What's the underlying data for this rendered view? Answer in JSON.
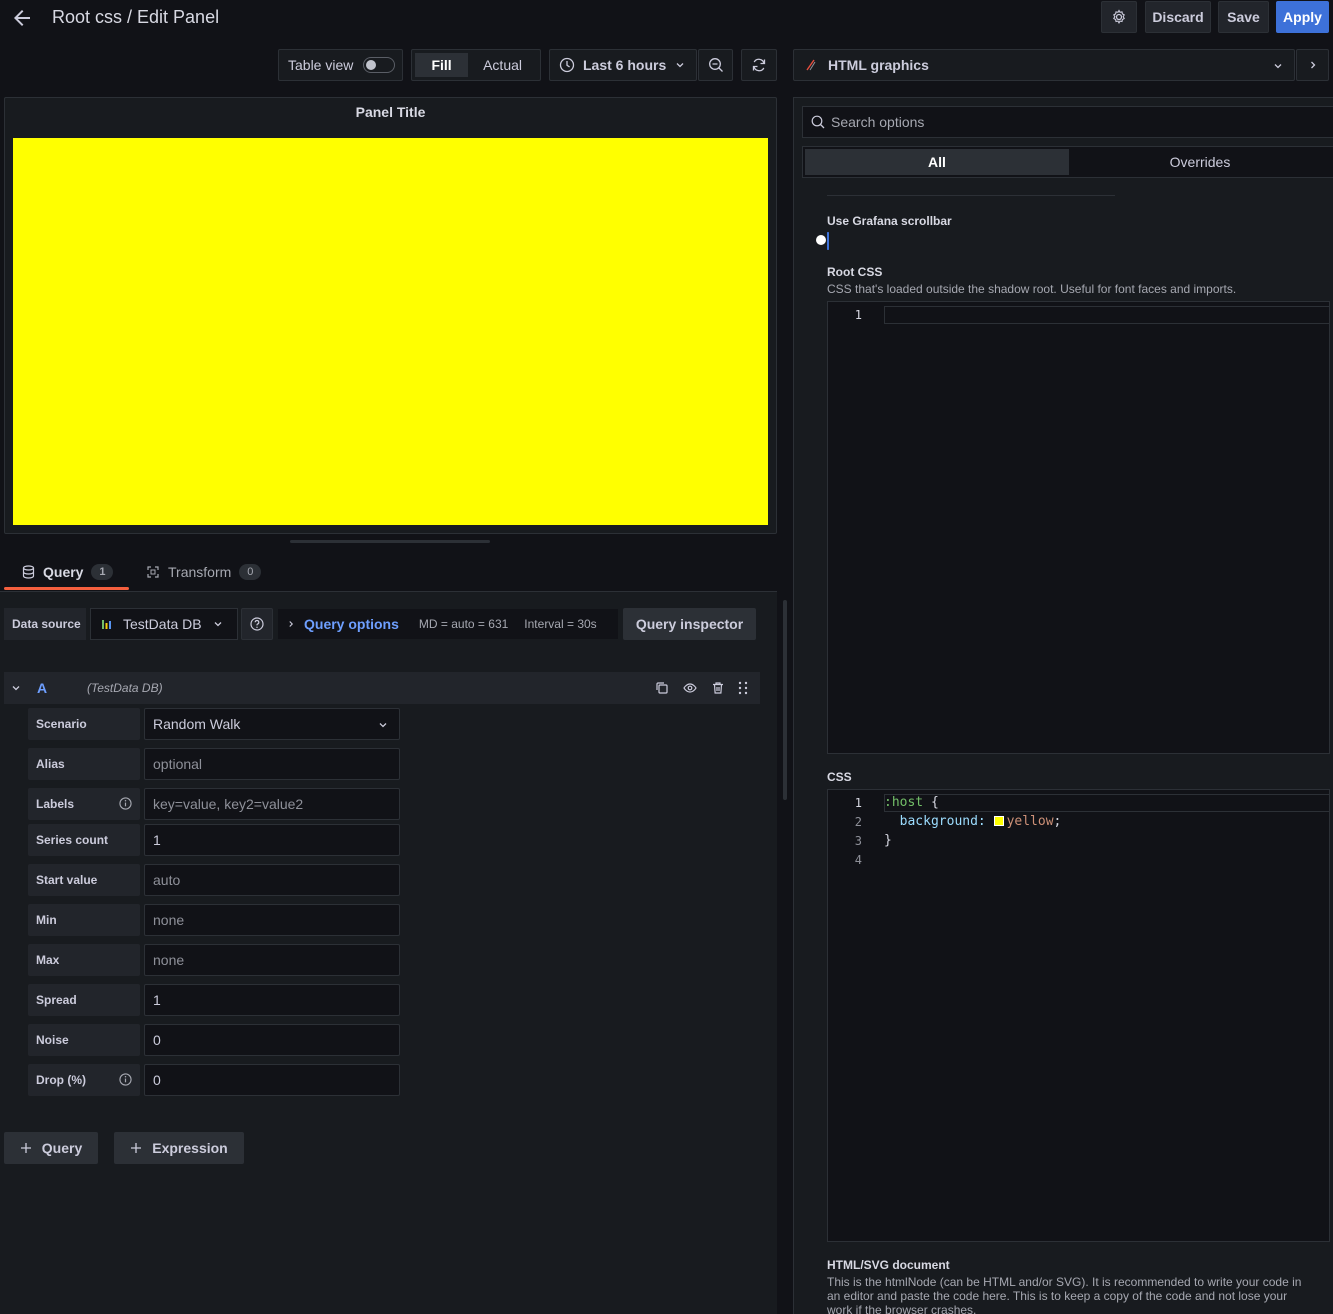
{
  "header": {
    "title": "Root css / Edit Panel",
    "discard_label": "Discard",
    "save_label": "Save",
    "apply_label": "Apply"
  },
  "toolbar": {
    "table_view_label": "Table view",
    "fill_label": "Fill",
    "actual_label": "Actual",
    "time_range": "Last 6 hours",
    "visualization": "HTML graphics"
  },
  "panel": {
    "title": "Panel Title",
    "background_color": "#ffff00"
  },
  "query_tabs": [
    {
      "label": "Query",
      "count": "1"
    },
    {
      "label": "Transform",
      "count": "0"
    }
  ],
  "datasource_row": {
    "data_source_label": "Data source",
    "data_source_value": "TestData DB",
    "query_options_label": "Query options",
    "md_label": "MD = auto = 631",
    "interval_label": "Interval = 30s",
    "inspector_label": "Query inspector"
  },
  "query_row": {
    "ref_id": "A",
    "datasource": "(TestData DB)"
  },
  "fields": [
    {
      "label": "Scenario",
      "value": "Random Walk",
      "placeholder": false
    },
    {
      "label": "Alias",
      "value": "optional",
      "placeholder": true
    },
    {
      "label": "Labels",
      "value": "key=value, key2=value2",
      "placeholder": true
    },
    {
      "label": "Series count",
      "value": "1",
      "placeholder": false
    },
    {
      "label": "Start value",
      "value": "auto",
      "placeholder": true
    },
    {
      "label": "Min",
      "value": "none",
      "placeholder": true
    },
    {
      "label": "Max",
      "value": "none",
      "placeholder": true
    },
    {
      "label": "Spread",
      "value": "1",
      "placeholder": false
    },
    {
      "label": "Noise",
      "value": "0",
      "placeholder": false
    },
    {
      "label": "Drop (%)",
      "value": "0",
      "placeholder": false
    }
  ],
  "add_buttons": {
    "query_label": "Query",
    "expression_label": "Expression"
  },
  "options_pane": {
    "search_placeholder": "Search options",
    "tab_all": "All",
    "tab_overrides": "Overrides",
    "scrollbar_label": "Use Grafana scrollbar",
    "root_css_label": "Root CSS",
    "root_css_desc": "CSS that's loaded outside the shadow root. Useful for font faces and imports.",
    "root_css_lines": [
      "1"
    ],
    "css_label": "CSS",
    "css_lines": [
      "1",
      "2",
      "3",
      "4"
    ],
    "css_code": {
      "line1_selector": ":host",
      "line1_brace": " {",
      "line2_prop": "  background: ",
      "line2_value": "yellow",
      "line2_semicolon": ";",
      "line3": "}"
    },
    "html_doc_label": "HTML/SVG document",
    "html_doc_desc": "This is the htmlNode (can be HTML and/or SVG). It is recommended to write your code in an editor and paste the code here. This is to keep a copy of the code and not lose your work if the browser crashes."
  },
  "colors": {
    "accent": "#3d71d9",
    "link": "#6e9fff",
    "yellow": "#ffff00",
    "background": "#111217"
  }
}
